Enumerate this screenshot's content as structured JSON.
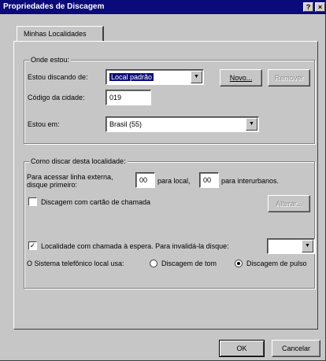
{
  "window": {
    "title": "Propriedades de Discagem",
    "help_glyph": "?",
    "close_glyph": "×"
  },
  "tab": {
    "label": "Minhas Localidades"
  },
  "where": {
    "group_title": "Onde estou:",
    "dialing_from_label": "Estou discando de:",
    "dialing_from_value": "Local padrão",
    "new_button": "Novo...",
    "remove_button": "Remover",
    "area_code_label": "Código da cidade:",
    "area_code_value": "019",
    "country_label": "Estou em:",
    "country_value": "Brasil (55)"
  },
  "how": {
    "group_title": "Como discar desta localidade:",
    "outside_line_label_1": "Para acessar linha externa,",
    "outside_line_label_2": "disque primeiro:",
    "local_value": "00",
    "local_label": "para local,",
    "long_distance_value": "00",
    "long_distance_label": "para interurbanos.",
    "calling_card_label": "Discagem com cartão de chamada",
    "calling_card_checked": false,
    "change_button": "Alterar...",
    "call_waiting_label": "Localidade com chamada à espera. Para invalidá-la disque:",
    "call_waiting_checked": true,
    "call_waiting_value": "",
    "phone_system_label": "O Sistema telefônico local usa:",
    "tone_label": "Discagem de tom",
    "pulse_label": "Discagem de pulso",
    "pulse_selected": true
  },
  "footer": {
    "ok_button": "OK",
    "cancel_button": "Cancelar"
  }
}
